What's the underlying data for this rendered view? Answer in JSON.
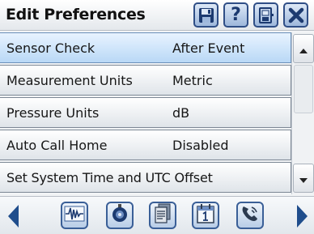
{
  "header": {
    "title": "Edit Preferences",
    "buttons": [
      {
        "name": "save",
        "icon": "save-disk-icon"
      },
      {
        "name": "help",
        "icon": "help-icon",
        "glyph": "?"
      },
      {
        "name": "exit",
        "icon": "exit-door-icon"
      },
      {
        "name": "close",
        "icon": "close-x-icon"
      }
    ]
  },
  "preferences": [
    {
      "label": "Sensor Check",
      "value": "After Event",
      "selected": true
    },
    {
      "label": "Measurement Units",
      "value": "Metric",
      "selected": false
    },
    {
      "label": "Pressure Units",
      "value": "dB",
      "selected": false
    },
    {
      "label": "Auto Call Home",
      "value": "Disabled",
      "selected": false
    },
    {
      "label": "Set System Time and UTC Offset",
      "value": "",
      "selected": false
    }
  ],
  "toolbar": {
    "buttons": [
      {
        "name": "waveform",
        "icon": "waveform-icon"
      },
      {
        "name": "sensor",
        "icon": "geophone-sensor-icon"
      },
      {
        "name": "reports",
        "icon": "documents-icon"
      },
      {
        "name": "calendar",
        "icon": "calendar-icon"
      },
      {
        "name": "call-home",
        "icon": "phone-icon"
      }
    ]
  },
  "colors": {
    "accent": "#2f4e86",
    "selected_row": "#b9d8f6",
    "nav_arrow": "#1f4d8c",
    "close_x": "#1c3a70"
  }
}
